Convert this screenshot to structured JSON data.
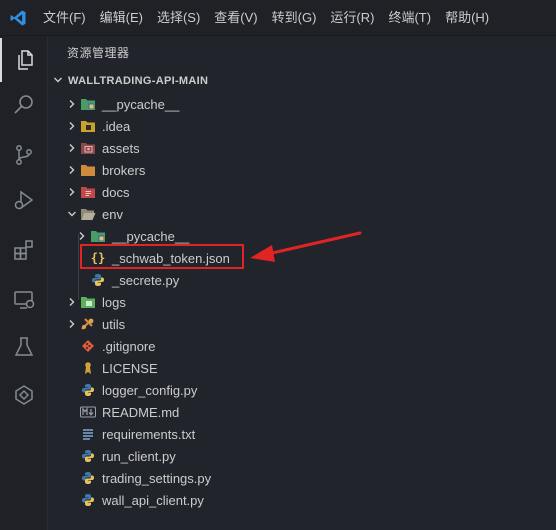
{
  "menubar": {
    "items": [
      "文件(F)",
      "编辑(E)",
      "选择(S)",
      "查看(V)",
      "转到(G)",
      "运行(R)",
      "终端(T)",
      "帮助(H)"
    ]
  },
  "activitybar": {
    "icons": [
      "explorer-icon",
      "search-icon",
      "source-control-icon",
      "run-debug-icon",
      "extensions-icon",
      "remote-explorer-icon",
      "testing-icon",
      "copilot-icon"
    ]
  },
  "sidebar": {
    "title": "资源管理器",
    "project": "WALLTRADING-API-MAIN",
    "tree": [
      {
        "label": "__pycache__",
        "kind": "folder",
        "icon": "python-folder-icon",
        "color": "#4a9b64"
      },
      {
        "label": ".idea",
        "kind": "folder",
        "icon": "idea-folder-icon",
        "color": "#c9a227"
      },
      {
        "label": "assets",
        "kind": "folder",
        "icon": "assets-folder-icon",
        "color": "#c0504d"
      },
      {
        "label": "brokers",
        "kind": "folder",
        "icon": "folder-icon",
        "color": "#d08a3c"
      },
      {
        "label": "docs",
        "kind": "folder",
        "icon": "docs-folder-icon",
        "color": "#d04a4a"
      },
      {
        "label": "env",
        "kind": "folder-open",
        "icon": "folder-open-icon",
        "color": "#8f8a7a"
      },
      {
        "label": "__pycache__",
        "kind": "folder",
        "icon": "python-folder-icon",
        "color": "#4a9b64"
      },
      {
        "label": "_schwab_token.json",
        "kind": "file",
        "icon": "json-icon",
        "color": "#e6c35c"
      },
      {
        "label": "_secrete.py",
        "kind": "file",
        "icon": "python-icon",
        "color": "#3c78aa"
      },
      {
        "label": "logs",
        "kind": "folder",
        "icon": "logs-folder-icon",
        "color": "#5bb05b"
      },
      {
        "label": "utils",
        "kind": "folder",
        "icon": "utils-folder-icon",
        "color": "#d08a3c"
      },
      {
        "label": ".gitignore",
        "kind": "file",
        "icon": "git-icon",
        "color": "#e05a3c"
      },
      {
        "label": "LICENSE",
        "kind": "file",
        "icon": "license-icon",
        "color": "#d4a03c"
      },
      {
        "label": "logger_config.py",
        "kind": "file",
        "icon": "python-icon",
        "color": "#3c78aa"
      },
      {
        "label": "README.md",
        "kind": "file",
        "icon": "markdown-icon",
        "color": "#9aa0a6"
      },
      {
        "label": "requirements.txt",
        "kind": "file",
        "icon": "text-file-icon",
        "color": "#7fa7d0"
      },
      {
        "label": "run_client.py",
        "kind": "file",
        "icon": "python-icon",
        "color": "#3c78aa"
      },
      {
        "label": "trading_settings.py",
        "kind": "file",
        "icon": "python-icon",
        "color": "#3c78aa"
      },
      {
        "label": "wall_api_client.py",
        "kind": "file",
        "icon": "python-icon",
        "color": "#3c78aa"
      }
    ]
  },
  "annotation": {
    "highlight_color": "#e02424"
  }
}
